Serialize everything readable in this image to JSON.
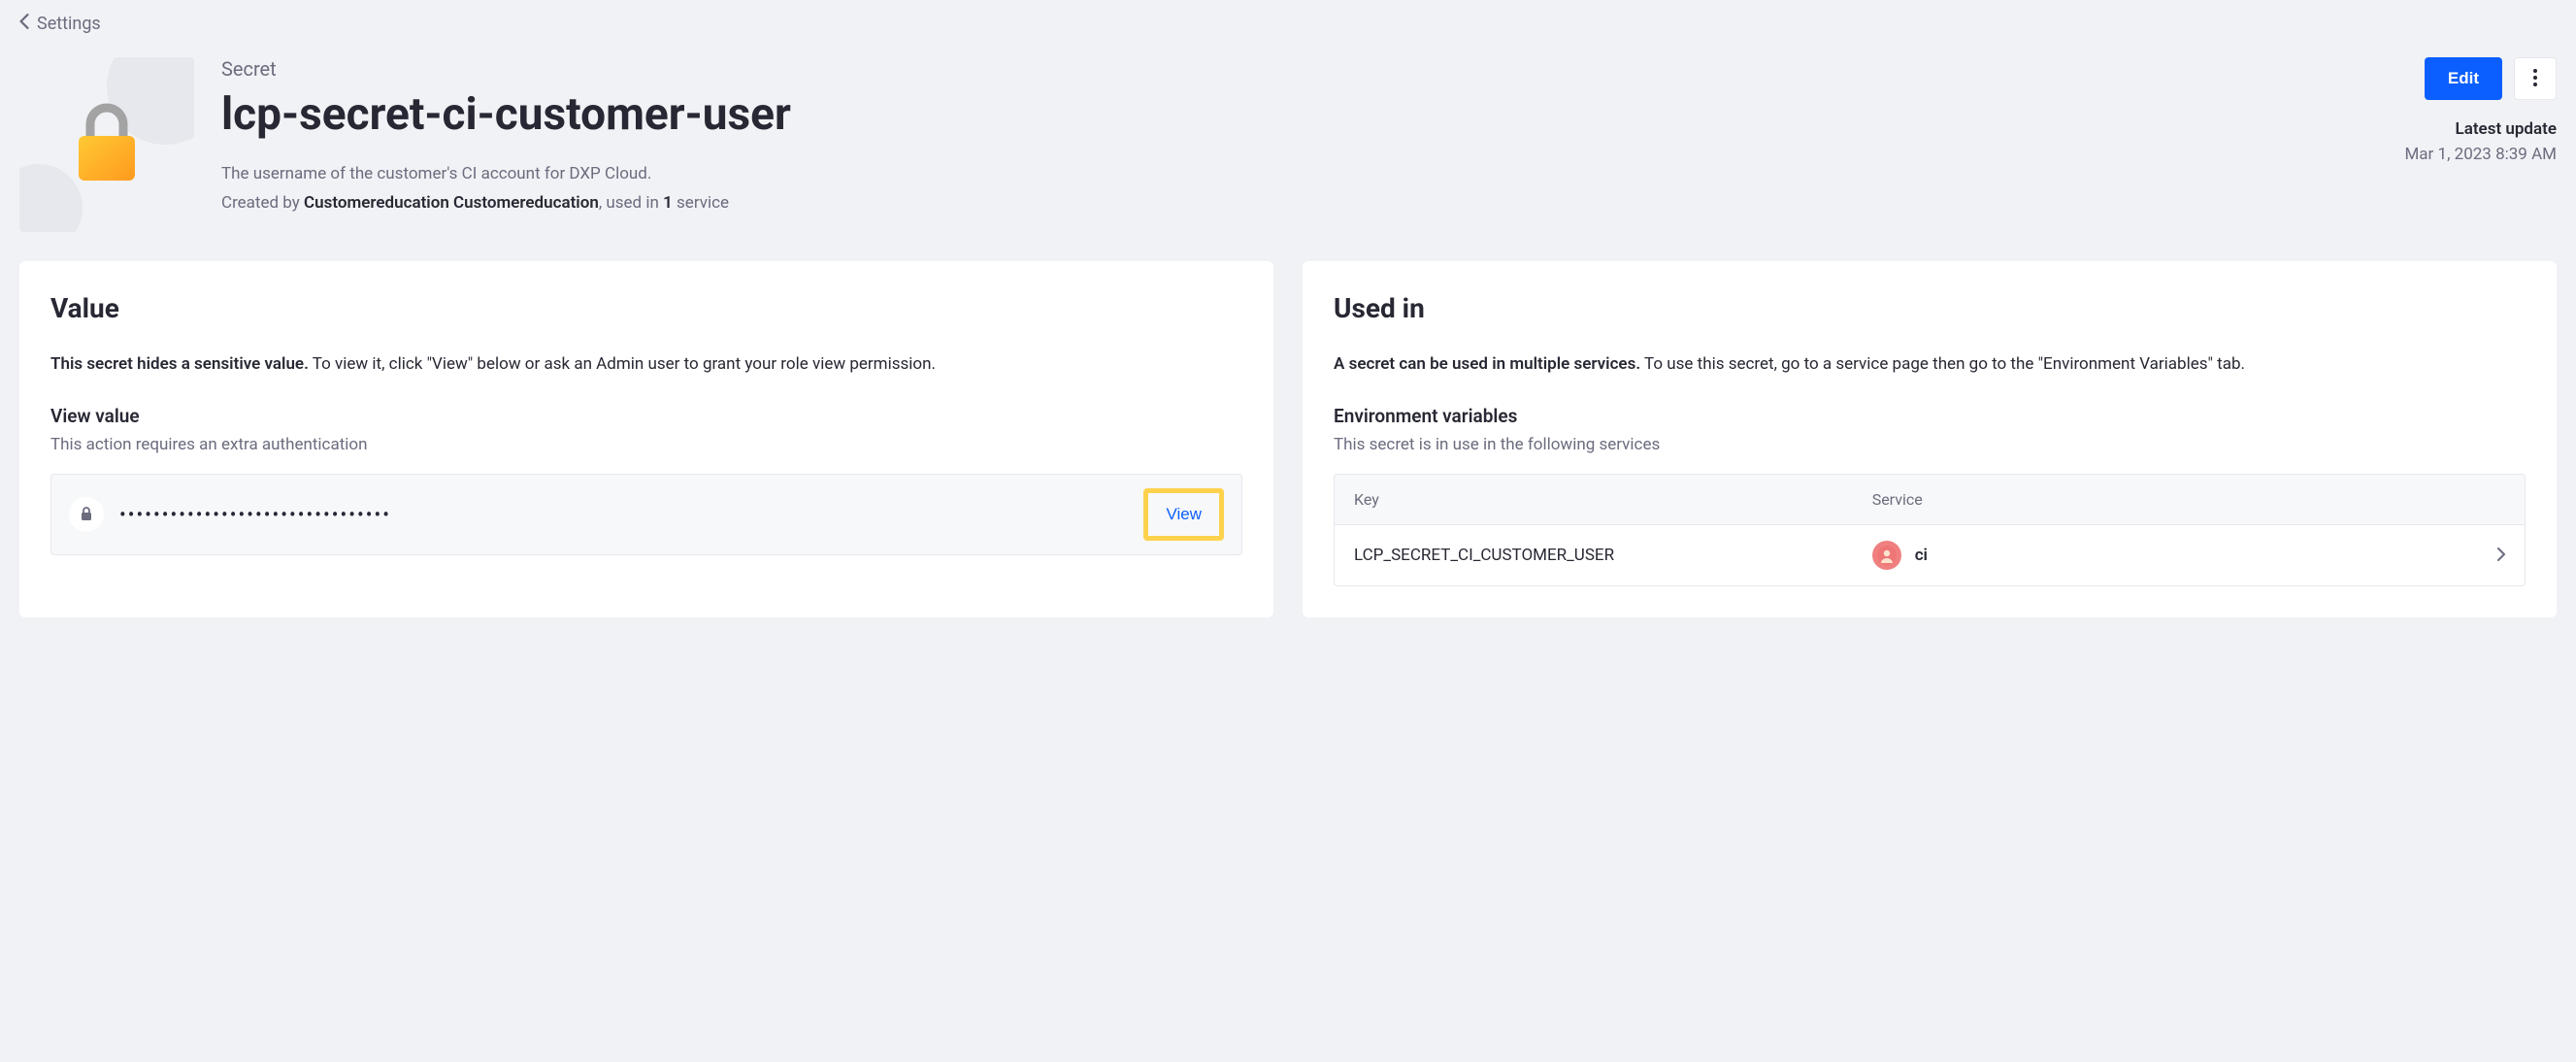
{
  "back": {
    "label": "Settings"
  },
  "header": {
    "category": "Secret",
    "title": "lcp-secret-ci-customer-user",
    "description": "The username of the customer's CI account for DXP Cloud.",
    "created_by_prefix": "Created by ",
    "created_by_name": "Customereducation Customereducation",
    "used_in_prefix": ", used in ",
    "used_in_count": "1",
    "used_in_suffix": " service",
    "edit_label": "Edit",
    "update_label": "Latest update",
    "update_time": "Mar 1, 2023 8:39 AM"
  },
  "value_card": {
    "title": "Value",
    "intro_bold": "This secret hides a sensitive value.",
    "intro_rest": " To view it, click \"View\" below or ask an Admin user to grant your role view permission.",
    "view_heading": "View value",
    "view_sub": "This action requires an extra authentication",
    "masked": "••••••••••••••••••••••••••••••••",
    "view_btn": "View"
  },
  "used_in_card": {
    "title": "Used in",
    "intro_bold": "A secret can be used in multiple services.",
    "intro_rest": " To use this secret, go to a service page then go to the \"Environment Variables\" tab.",
    "env_heading": "Environment variables",
    "env_sub": "This secret is in use in the following services",
    "col_key": "Key",
    "col_service": "Service",
    "rows": [
      {
        "key": "LCP_SECRET_CI_CUSTOMER_USER",
        "service": "ci"
      }
    ]
  }
}
